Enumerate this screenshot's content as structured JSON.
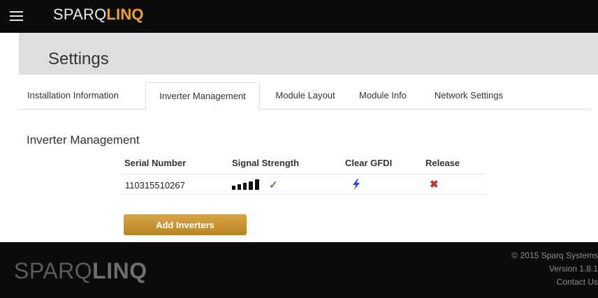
{
  "header": {
    "brand_part1": "SPARQ",
    "brand_part2": "LINQ",
    "menu_icon": "hamburger-icon",
    "brand_color": "#f0a325"
  },
  "page": {
    "title": "Settings"
  },
  "tabs": [
    {
      "label": "Installation Information",
      "active": false
    },
    {
      "label": "Inverter Management",
      "active": true
    },
    {
      "label": "Module Layout",
      "active": false
    },
    {
      "label": "Module Info",
      "active": false
    },
    {
      "label": "Network Settings",
      "active": false
    }
  ],
  "inverter_management": {
    "section_title": "Inverter Management",
    "columns": [
      "Serial Number",
      "Signal Strength",
      "Clear GFDI",
      "Release"
    ],
    "rows": [
      {
        "serial_number": "110315510267",
        "signal_bars_filled": 5,
        "signal_bars_total": 5,
        "signal_ok_icon": "checkmark-icon",
        "clear_gfdi_icon": "lightning-bolt-icon",
        "release_icon": "x-icon"
      }
    ],
    "add_button_label": "Add Inverters"
  },
  "footer": {
    "logo_part1": "SPARQ",
    "logo_part2": "LINQ",
    "copyright": "© 2015 Sparq Systems",
    "version": "Version 1.8.1",
    "contact": "Contact Us"
  },
  "colors": {
    "topbar": "#0b0b0b",
    "accent": "#f0a325",
    "button": "#c8952e",
    "check": "#2ca02c",
    "bolt": "#2a3fd6",
    "release": "#b13a2b"
  }
}
